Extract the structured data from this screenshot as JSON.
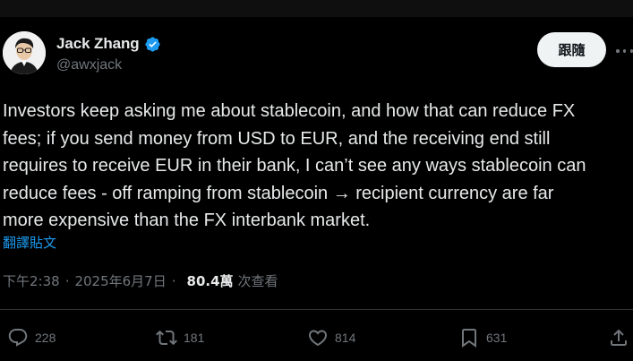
{
  "author": {
    "name": "Jack Zhang",
    "handle": "@awxjack",
    "verified": true,
    "avatar_icon": "user-avatar"
  },
  "follow_button": {
    "label": "跟隨"
  },
  "more_icon": "ellipsis-icon",
  "post": {
    "lines": [
      "Investors keep asking me about stablecoin, and how that can reduce FX",
      "fees; if you send money from USD to EUR, and the receiving end still",
      "requires to receive EUR in their bank, I can’t see any ways stablecoin can",
      "reduce fees - off ramping from stablecoin → recipient currency are far",
      "more expensive than the FX interbank market."
    ]
  },
  "translate_link": "翻譯貼文",
  "meta": {
    "time": "下午2:38",
    "date": "2025年6月7日",
    "views_count": "80.4萬",
    "views_label": "次查看"
  },
  "actions": {
    "reply": {
      "count": "228",
      "icon": "reply-icon"
    },
    "retweet": {
      "count": "181",
      "icon": "retweet-icon"
    },
    "like": {
      "count": "814",
      "icon": "heart-icon"
    },
    "bookmark": {
      "count": "631",
      "icon": "bookmark-icon"
    },
    "share": {
      "icon": "share-icon"
    }
  },
  "colors": {
    "background": "#000000",
    "text": "#e7e9ea",
    "secondary": "#71767b",
    "link": "#1d9bf0",
    "verified": "#1d9bf0"
  }
}
